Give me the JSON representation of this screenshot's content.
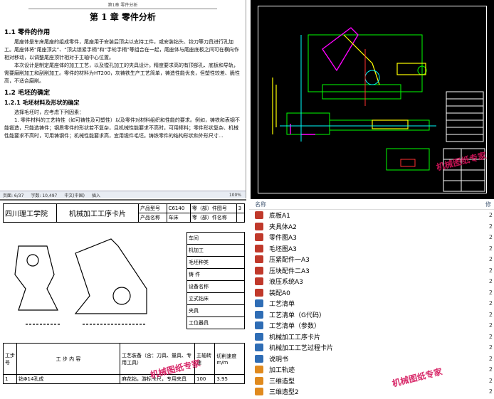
{
  "doc": {
    "header": "第1章  零件分析",
    "chapter": "第 1 章    零件分析",
    "sec1": "1.1 零件的作用",
    "p1": "尾座体是车床尾座的组成零件，尾座用于安装后顶尖以支持工件，或安装钻头、铰刀等刀具进行孔加工。尾座体将“尾座顶尖”、“顶尖锁紧手柄”和“手轮手柄”等组合在一起，尾座体与尾座底板之间可在横向作相对移动，以调整尾座顶针相对于主轴中心位置。",
    "p2": "本次设计是制定尾座体的加工工艺，以及镗孔加工的夹具设计。精度要求高的有顶部孔、底板和导轨，需要磨削加工和刮削加工。零件的材料为HT200，灰铸铁生产工艺简单，铸造性能优良，但塑性较差、脆性高，不适合磨削。",
    "sec2": "1.2 毛坯的确定",
    "sec21": "1.2.1 毛坯材料及形状的确定",
    "p3": "选择毛坯时，应考虑下列因素：",
    "p4": "1. 零件材料的工艺特性（如可铸性及可塑性）以及零件对材料组织和性能的要求。例如，铸铁和表钢不能锻造，只能选铸件；钢质零件的形状若不复杂，且机械性能要求不高时，可用棒料；零件形状复杂、机械性能要求不高时，可用铸钢件；机械性能要求高，宜用锻件毛坯。铸铁零件的结构形状和外形尺寸...",
    "status": [
      "页面: 6/37",
      "字数: 10,497",
      "中文(中国)",
      "插入",
      "100%"
    ]
  },
  "card": {
    "school": "四川理工学院",
    "title": "机械加工工序卡片",
    "product_model_label": "产品型号",
    "product_model": "C6140",
    "product_name_label": "产品名称",
    "product_name": "车床",
    "part_no_label": "零（部）件图号",
    "part_name_label": "零（部）件名称",
    "sheet": "3",
    "workshop": "车间",
    "machine": "机加工",
    "blank_type": "毛坯种类",
    "blank": "铸 件",
    "blank_size": "90x",
    "equip_name": "设备名称",
    "equip": "立式钻床",
    "fixture": "夹具",
    "station": "工位器具",
    "step_no": "工步号",
    "step_content": "工  步  内  容",
    "process_equip": "工艺装备（含：刀具、量具、专用工具）",
    "spindle": "主轴转速",
    "cut_speed": "切削速度 m/m",
    "row1_no": "1",
    "row1": "钻Φ14孔成",
    "row1_tool": "麻花钻，游标卡尺，专用夹具",
    "row1_speed": "100",
    "row1_v": "3.95"
  },
  "files": {
    "column": "名称",
    "column2": "修",
    "items": [
      {
        "name": "底板A1",
        "icon": "red"
      },
      {
        "name": "夹具体A2",
        "icon": "red"
      },
      {
        "name": "零件图A3",
        "icon": "red"
      },
      {
        "name": "毛坯图A3",
        "icon": "red"
      },
      {
        "name": "压紧配件一A3",
        "icon": "red"
      },
      {
        "name": "压块配件二A3",
        "icon": "red"
      },
      {
        "name": "液压系统A3",
        "icon": "red"
      },
      {
        "name": "装配A0",
        "icon": "red"
      },
      {
        "name": "工艺清单",
        "icon": "blue"
      },
      {
        "name": "工艺清单（G代码）",
        "icon": "blue"
      },
      {
        "name": "工艺清单（参数）",
        "icon": "blue"
      },
      {
        "name": "机械加工工序卡片",
        "icon": "blue"
      },
      {
        "name": "机械加工工艺过程卡片",
        "icon": "blue"
      },
      {
        "name": "说明书",
        "icon": "blue"
      },
      {
        "name": "加工轨迹",
        "icon": "orange"
      },
      {
        "name": "三维造型",
        "icon": "orange"
      },
      {
        "name": "三维造型2",
        "icon": "orange"
      }
    ],
    "date": "2"
  },
  "watermark": "机械图纸专家",
  "colors": {
    "red": "#c0392b",
    "blue": "#2f6db5",
    "orange": "#e08a1e",
    "wm": "#d4145a"
  }
}
